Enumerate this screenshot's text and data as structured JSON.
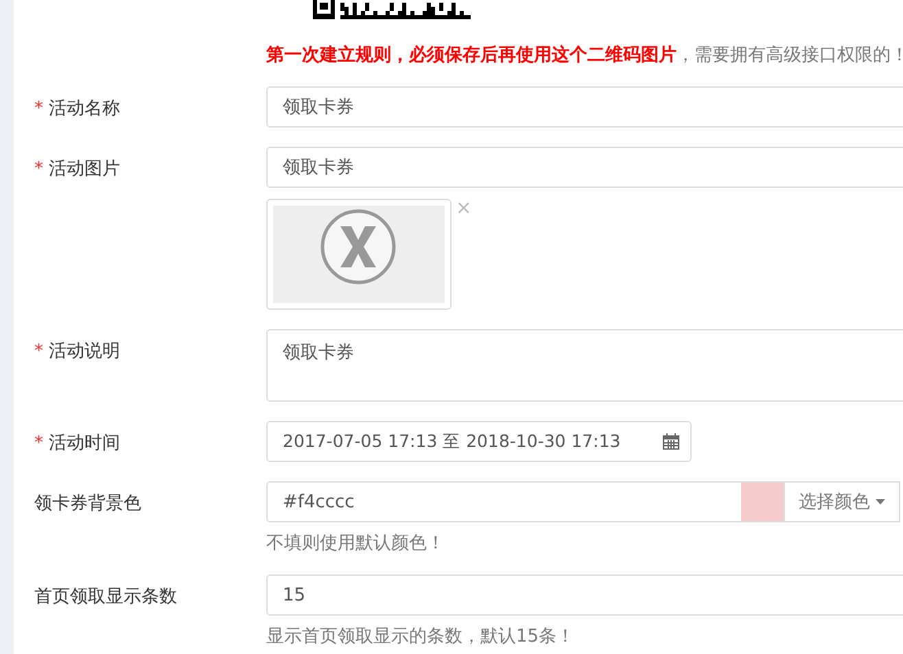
{
  "required_mark": "*",
  "notice": "**第一次建立规则，必须保存后再使用这个二维码图片**，需要拥有高级接口权限的！",
  "fields": [
    {
      "kind": "text",
      "label": "活动名称",
      "required": true,
      "value": "领取卡券"
    },
    {
      "kind": "image",
      "label": "活动图片",
      "required": true,
      "value": "领取卡券",
      "remove": "×"
    },
    {
      "kind": "textarea",
      "label": "活动说明",
      "required": true,
      "value": "领取卡券"
    },
    {
      "kind": "daterange",
      "label": "活动时间",
      "required": true,
      "value": "2017-07-05 17:13 至 2018-10-30 17:13"
    },
    {
      "kind": "color",
      "label": "领卡券背景色",
      "required": false,
      "value": "#f4cccc",
      "color": "#f4cccc",
      "button": "选择颜色",
      "hint": "不填则使用默认颜色！"
    },
    {
      "kind": "text",
      "label": "首页领取显示条数",
      "required": false,
      "value": "15",
      "hint": "显示首页领取显示的条数，默认15条！"
    }
  ]
}
